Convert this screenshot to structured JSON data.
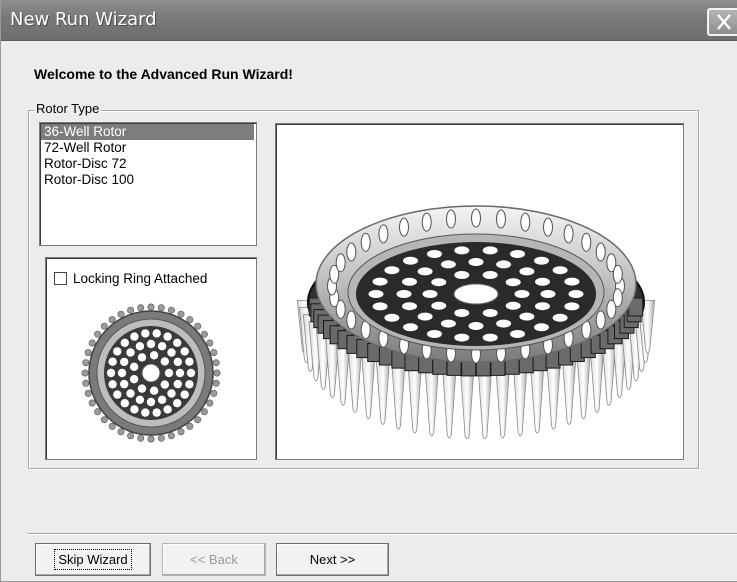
{
  "window": {
    "title": "New Run Wizard"
  },
  "wizard": {
    "heading": "Welcome to the Advanced Run Wizard!"
  },
  "rotor_type": {
    "group_label": "Rotor Type",
    "items": [
      {
        "label": "36-Well Rotor",
        "selected": true
      },
      {
        "label": "72-Well Rotor",
        "selected": false
      },
      {
        "label": "Rotor-Disc 72",
        "selected": false
      },
      {
        "label": "Rotor-Disc 100",
        "selected": false
      }
    ]
  },
  "locking_ring": {
    "label": "Locking Ring Attached",
    "checked": false
  },
  "buttons": {
    "skip": "Skip Wizard",
    "back": "<< Back",
    "next": "Next >>"
  },
  "icons": {
    "close": "close-icon",
    "rotor_small": "rotor-thumbnail-image",
    "rotor_large": "rotor-preview-image"
  },
  "colors": {
    "selection": "#7d7d7d",
    "titlebar": "#7a7a7a"
  }
}
